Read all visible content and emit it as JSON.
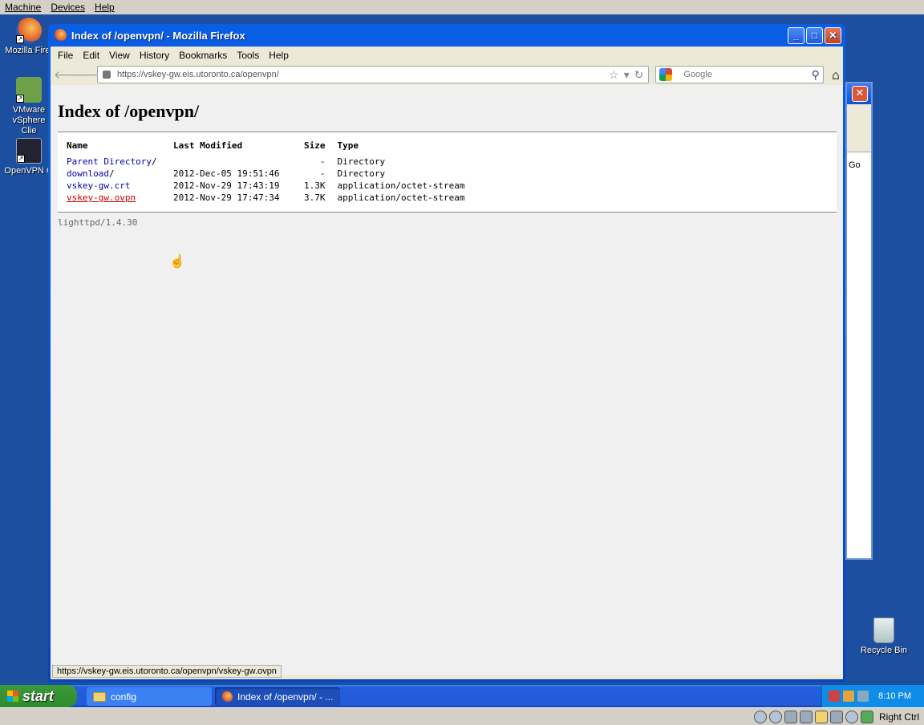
{
  "host": {
    "menu": [
      "Machine",
      "Devices",
      "Help"
    ],
    "right_ctrl": "Right Ctrl"
  },
  "desktop": {
    "icons": [
      {
        "label": "Mozilla Firef",
        "icon": "firefox-icon"
      },
      {
        "label": "VMware vSphere Clie",
        "icon": "vsphere-icon"
      },
      {
        "label": "OpenVPN G",
        "icon": "openvpn-icon"
      },
      {
        "label": "Recycle Bin",
        "icon": "recycle-bin-icon"
      }
    ],
    "bg_window_go": "Go"
  },
  "firefox": {
    "title": "Index of /openvpn/ - Mozilla Firefox",
    "menu": [
      "File",
      "Edit",
      "View",
      "History",
      "Bookmarks",
      "Tools",
      "Help"
    ],
    "url": "https://vskey-gw.eis.utoronto.ca/openvpn/",
    "search_placeholder": "Google",
    "status_url": "https://vskey-gw.eis.utoronto.ca/openvpn/vskey-gw.ovpn"
  },
  "page": {
    "heading": "Index of /openvpn/",
    "columns": [
      "Name",
      "Last Modified",
      "Size",
      "Type"
    ],
    "rows": [
      {
        "name": "Parent Directory",
        "suffix": "/",
        "modified": "",
        "size": "-",
        "type": "Directory"
      },
      {
        "name": "download",
        "suffix": "/",
        "modified": "2012-Dec-05 19:51:46",
        "size": "-",
        "type": "Directory"
      },
      {
        "name": "vskey-gw.crt",
        "suffix": "",
        "modified": "2012-Nov-29 17:43:19",
        "size": "1.3K",
        "type": "application/octet-stream"
      },
      {
        "name": "vskey-gw.ovpn",
        "suffix": "",
        "modified": "2012-Nov-29 17:47:34",
        "size": "3.7K",
        "type": "application/octet-stream"
      }
    ],
    "server": "lighttpd/1.4.30"
  },
  "taskbar": {
    "start": "start",
    "tasks": [
      "config",
      "Index of /openvpn/ - ..."
    ],
    "clock": "8:10 PM"
  }
}
